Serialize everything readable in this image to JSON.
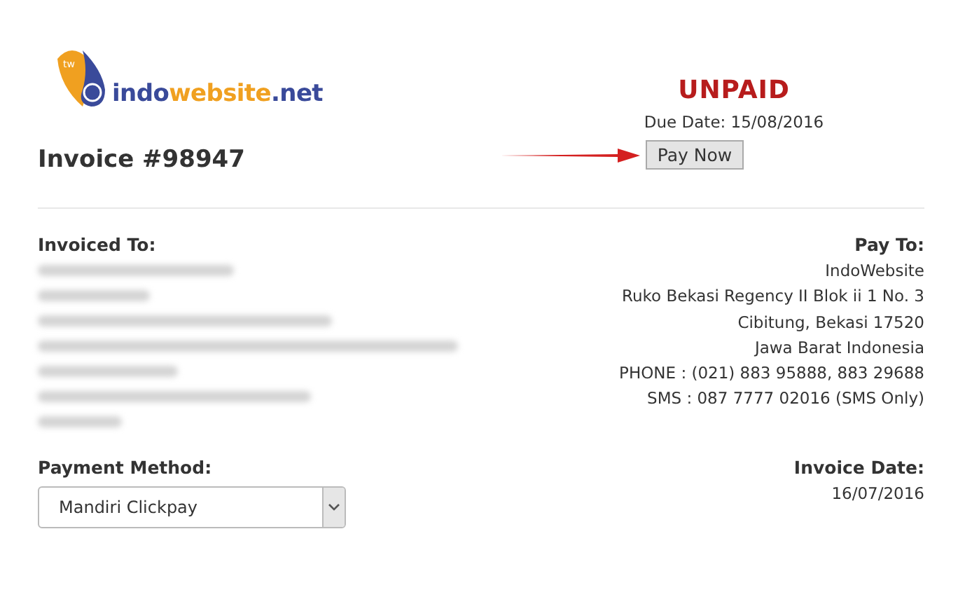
{
  "logo": {
    "badge": "tw",
    "parts": [
      {
        "text": "indo",
        "color": "#3a4a9a"
      },
      {
        "text": "website",
        "color": "#f0a020"
      },
      {
        "text": ".net",
        "color": "#3a4a9a"
      }
    ]
  },
  "invoice_title": "Invoice #98947",
  "status": "UNPAID",
  "due_date": "Due Date: 15/08/2016",
  "pay_button": "Pay Now",
  "invoiced_to": {
    "heading": "Invoiced To:",
    "lines": [
      {
        "kind": "redacted"
      },
      {
        "kind": "redacted"
      },
      {
        "kind": "redacted"
      },
      {
        "kind": "redacted"
      },
      {
        "kind": "redacted"
      },
      {
        "kind": "redacted"
      },
      {
        "kind": "redacted"
      }
    ]
  },
  "pay_to": {
    "heading": "Pay To:",
    "lines": [
      "IndoWebsite",
      "Ruko Bekasi Regency II Blok ii 1 No. 3",
      "Cibitung, Bekasi 17520",
      "Jawa Barat Indonesia",
      "PHONE : (021) 883 95888, 883 29688",
      "SMS : 087 7777 02016 (SMS Only)"
    ]
  },
  "payment_method": {
    "heading": "Payment Method:",
    "value": "Mandiri Clickpay"
  },
  "invoice_date": {
    "heading": "Invoice Date:",
    "value": "16/07/2016"
  }
}
